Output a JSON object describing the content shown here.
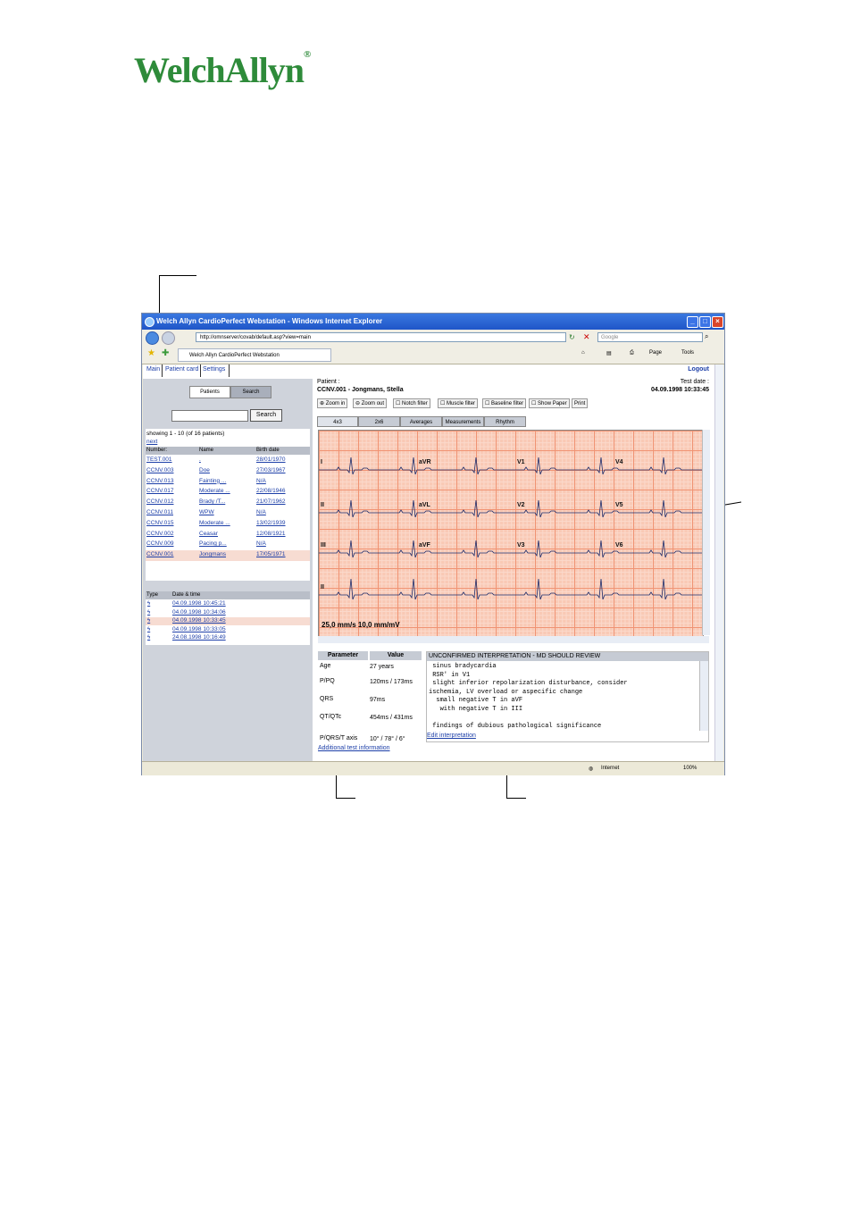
{
  "logo": {
    "text": "WelchAllyn",
    "reg": "®"
  },
  "browser": {
    "title": "Welch Allyn CardioPerfect Webstation - Windows Internet Explorer",
    "address": "http://omnserver/covab/default.asp?view=main",
    "search_placeholder": "Google",
    "tab_label": "Welch Allyn CardioPerfect Webstation",
    "page_menu": "Page",
    "tools_menu": "Tools",
    "status_zone": "Internet",
    "zoom": "100%"
  },
  "menu": {
    "main": "Main",
    "patient_card": "Patient card",
    "settings": "Settings",
    "logout": "Logout"
  },
  "left": {
    "tab_patients": "Patients",
    "tab_search": "Search",
    "search_button": "Search",
    "showing": "showing 1 - 10 (of 16 patients)",
    "next": "next",
    "headers": {
      "number": "Number:",
      "name": "Name",
      "birth": "Birth date"
    },
    "patients": [
      {
        "number": "TEST.001",
        "name": ".",
        "birth": "28/01/1970"
      },
      {
        "number": "CCNV.003",
        "name": "Doe",
        "birth": "27/03/1967"
      },
      {
        "number": "CCNV.013",
        "name": "Fainting ...",
        "birth": "N/A"
      },
      {
        "number": "CCNV.017",
        "name": "Moderate ...",
        "birth": "22/08/1946"
      },
      {
        "number": "CCNV.012",
        "name": "Brady /T...",
        "birth": "21/07/1962"
      },
      {
        "number": "CCNV.011",
        "name": "WPW",
        "birth": "N/A"
      },
      {
        "number": "CCNV.015",
        "name": "Moderate ...",
        "birth": "13/02/1939"
      },
      {
        "number": "CCNV.002",
        "name": "Ceasar",
        "birth": "12/08/1921"
      },
      {
        "number": "CCNV.009",
        "name": "Pacing p...",
        "birth": "N/A"
      },
      {
        "number": "CCNV.001",
        "name": "Jongmans",
        "birth": "17/05/1971"
      }
    ],
    "history_headers": {
      "type": "Type",
      "datetime": "Date & time"
    },
    "history": [
      {
        "datetime": "04.09.1998 10:45:21"
      },
      {
        "datetime": "04.09.1998 10:34:06"
      },
      {
        "datetime": "04.09.1998 10:33:45"
      },
      {
        "datetime": "04.09.1998 10:33:05"
      },
      {
        "datetime": "24.08.1998 10:16:49"
      }
    ]
  },
  "right": {
    "patient_label": "Patient :",
    "patient_name": "CCNV.001 - Jongmans, Stella",
    "testdate_label": "Test date :",
    "testdate": "04.09.1998 10:33:45",
    "toolbar": {
      "zoom_in": "Zoom in",
      "zoom_out": "Zoom out",
      "notch": "Notch filter",
      "muscle": "Muscle filter",
      "baseline": "Baseline filter",
      "paper": "Show Paper",
      "print": "Print"
    },
    "tabs": [
      "4x3",
      "2x6",
      "Averages",
      "Measurements",
      "Rhythm"
    ],
    "leads": [
      "I",
      "aVR",
      "V1",
      "V4",
      "II",
      "aVL",
      "V2",
      "V5",
      "III",
      "aVF",
      "V3",
      "V6",
      "II"
    ],
    "speed": "25,0 mm/s 10,0 mm/mV",
    "params_header": {
      "param": "Parameter",
      "value": "Value"
    },
    "params": [
      {
        "name": "Age",
        "value": "27 years"
      },
      {
        "name": "P/PQ",
        "value": "120ms / 173ms"
      },
      {
        "name": "QRS",
        "value": "97ms"
      },
      {
        "name": "QT/QTc",
        "value": "454ms / 431ms"
      },
      {
        "name": "P/QRS/T axis",
        "value": "10° / 78° / 6°"
      }
    ],
    "interp_header": "UNCONFIRMED INTERPRETATION - MD SHOULD REVIEW",
    "interp_text": " sinus bradycardia\n RSR' in V1\n slight inferior repolarization disturbance, consider\nischemia, LV overload or aspecific change\n  small negative T in aVF\n   with negative T in III\n\n findings of dubious pathological significance",
    "edit_link": "Edit interpretation",
    "additional_link": "Additional test information"
  }
}
